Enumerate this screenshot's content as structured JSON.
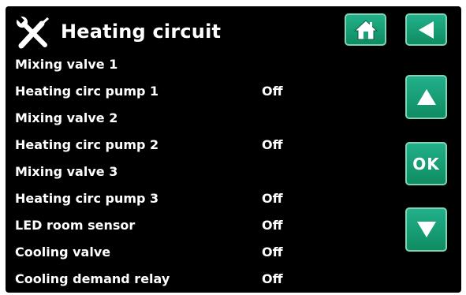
{
  "header": {
    "title": "Heating circuit",
    "icon": "tools-icon"
  },
  "buttons": {
    "home_icon": "home-icon",
    "back_icon": "back-arrow-icon",
    "up_icon": "up-arrow-icon",
    "ok_label": "OK",
    "down_icon": "down-arrow-icon"
  },
  "colors": {
    "background": "#000000",
    "text": "#ffffff",
    "button_green": "#18a077"
  },
  "rows": [
    {
      "label": "Mixing valve 1",
      "value": ""
    },
    {
      "label": "Heating circ pump 1",
      "value": "Off"
    },
    {
      "label": "Mixing valve 2",
      "value": ""
    },
    {
      "label": "Heating circ pump 2",
      "value": "Off"
    },
    {
      "label": "Mixing valve 3",
      "value": ""
    },
    {
      "label": "Heating circ pump 3",
      "value": "Off"
    },
    {
      "label": "LED room sensor",
      "value": "Off"
    },
    {
      "label": "Cooling valve",
      "value": "Off"
    },
    {
      "label": "Cooling demand relay",
      "value": "Off"
    }
  ]
}
